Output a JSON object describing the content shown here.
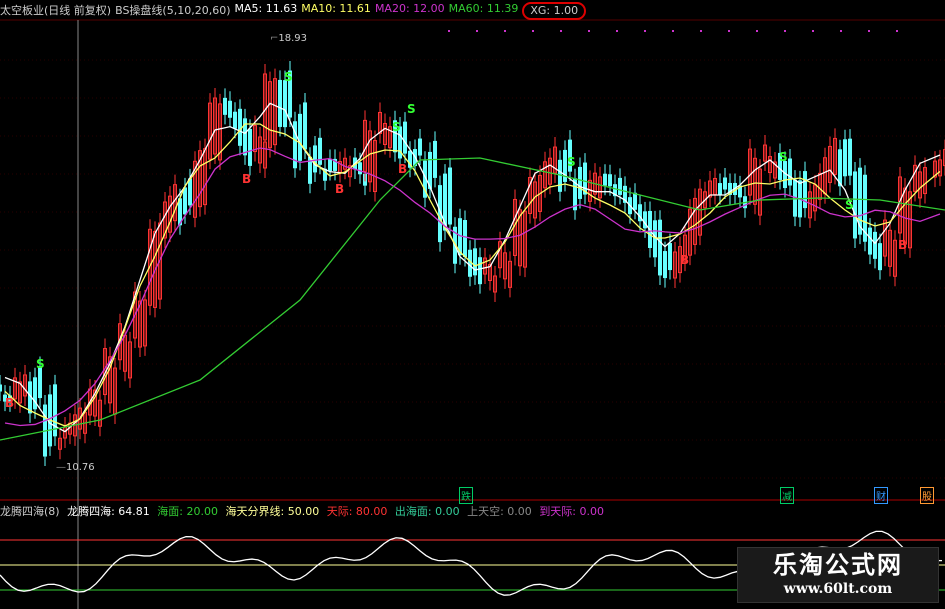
{
  "header": {
    "stock_name": "太空板业(日线 前复权)",
    "indicator_name": "BS操盘线(5,10,20,60)",
    "ma5": "MA5: 11.63",
    "ma10": "MA10: 11.61",
    "ma20": "MA20: 12.00",
    "ma60": "MA60: 11.39",
    "xg": "XG: 1.00"
  },
  "price_labels": {
    "high": "18.93",
    "low": "10.76"
  },
  "signals": {
    "buy": "B",
    "sell": "S"
  },
  "event_tags": [
    {
      "text": "跌",
      "color": "#00cc66"
    },
    {
      "text": "减",
      "color": "#00cc66"
    },
    {
      "text": "财",
      "color": "#3399ff"
    },
    {
      "text": "股",
      "color": "#ff9933"
    }
  ],
  "sub_indicator": {
    "name": "龙腾四海(8)",
    "main_value": "龙腾四海: 64.81",
    "haimian": "海面: 20.00",
    "fenjie": "海天分界线: 50.00",
    "tianjie": "天际: 80.00",
    "chuhaimian": "出海面: 0.00",
    "shangtiankong": "上天空: 0.00",
    "daotianjie": "到天际: 0.00"
  },
  "watermark": {
    "title": "乐淘公式网",
    "url": "www.60lt.com"
  },
  "colors": {
    "up": "#ff3333",
    "down": "#66ffff",
    "ma5": "#ffffff",
    "ma10": "#ffff66",
    "ma20": "#cc33cc",
    "ma60": "#33cc33",
    "sell_signal": "#33ff33",
    "buy_signal": "#ff3333"
  }
}
